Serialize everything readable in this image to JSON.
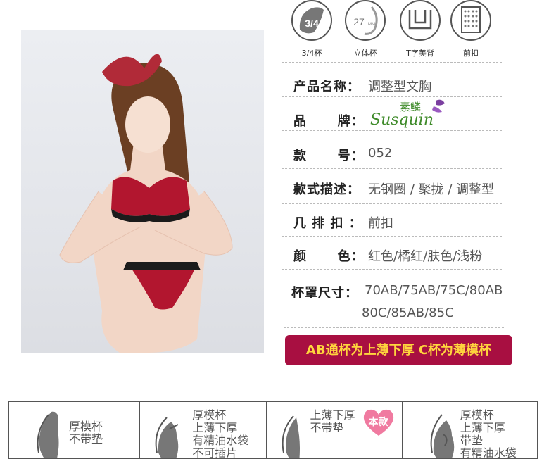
{
  "features": [
    {
      "icon": "three-quarter-cup-icon",
      "text": "3/4",
      "label": "3/4杯"
    },
    {
      "icon": "3d-body-icon",
      "text": "27",
      "sub": "MM",
      "label": "立体杯"
    },
    {
      "icon": "t-back-icon",
      "label": "T字美背"
    },
    {
      "icon": "front-clasp-icon",
      "label": "前扣"
    }
  ],
  "specs": {
    "name_key": "产品名称：",
    "name_val": "调整型文胸",
    "brand_key": "品      牌：",
    "brand_logo_cn": "素鳞",
    "brand_logo_en": "Susquin",
    "model_key": "款      号：",
    "model_val": "052",
    "style_key": "款式描述：",
    "style_val": "无钢圈 / 聚拢 / 调整型",
    "clasp_key": "几 排 扣 ：",
    "clasp_val": "前扣",
    "color_key": "颜      色：",
    "color_val": "红色/橘红/肤色/浅粉",
    "size_key": "杯罩尺寸：",
    "size_line1": "70AB/75AB/75C/80AB",
    "size_line2": "80C/85AB/85C"
  },
  "banner": "AB通杯为上薄下厚  C杯为薄模杯",
  "cups": [
    {
      "lines": [
        "厚模杯",
        "不带垫"
      ]
    },
    {
      "lines": [
        "厚模杯",
        "上薄下厚",
        "有精油水袋",
        "不可插片"
      ]
    },
    {
      "lines": [
        "上薄下厚",
        "不带垫"
      ],
      "badge": "本款"
    },
    {
      "lines": [
        "厚模杯",
        "上薄下厚",
        "带垫",
        "有精油水袋"
      ]
    }
  ],
  "colors": {
    "accent": "#a80f41",
    "banner_text": "#ffd53d",
    "heart": "#f07aa0"
  }
}
